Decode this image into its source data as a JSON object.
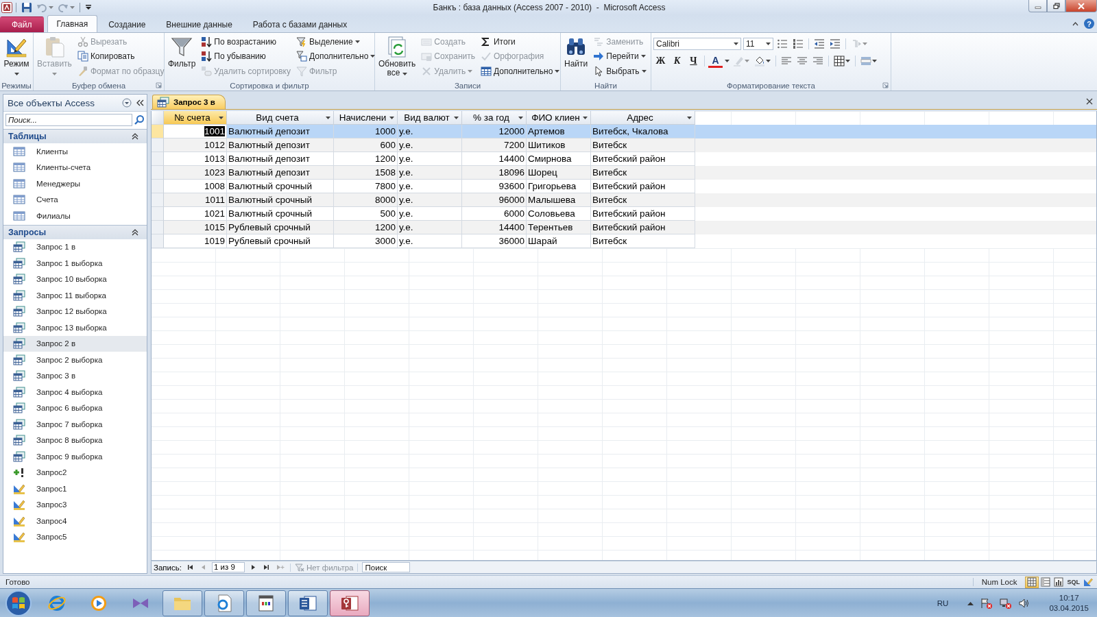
{
  "window": {
    "title": "Банкъ : база данных (Access 2007 - 2010)  -  Microsoft Access"
  },
  "quick_access": [
    {
      "kind": "save",
      "disabled": false
    },
    {
      "kind": "undo",
      "disabled": true
    },
    {
      "kind": "redo",
      "disabled": true
    }
  ],
  "ribbon_tabs": [
    {
      "label": "Файл",
      "kind": "file",
      "selected": false
    },
    {
      "label": "Главная",
      "kind": "tab",
      "selected": true
    },
    {
      "label": "Создание",
      "kind": "tab",
      "selected": false
    },
    {
      "label": "Внешние данные",
      "kind": "tab",
      "selected": false
    },
    {
      "label": "Работа с базами данных",
      "kind": "tab",
      "selected": false
    }
  ],
  "help_button": "?",
  "ribbon_groups": [
    {
      "label": "Режимы",
      "launcher": false,
      "columns": [
        {
          "kind": "large",
          "items": [
            {
              "label": "Режим",
              "disabled": false,
              "dropdown": true
            }
          ]
        }
      ]
    },
    {
      "label": "Буфер обмена",
      "launcher": true,
      "columns": [
        {
          "kind": "large",
          "items": [
            {
              "label": "Вставить",
              "disabled": true,
              "dropdown": true
            }
          ]
        },
        {
          "kind": "small",
          "items": [
            {
              "label": "Вырезать",
              "disabled": true,
              "dropdown": false
            },
            {
              "label": "Копировать",
              "disabled": false,
              "dropdown": false
            },
            {
              "label": "Формат по образцу",
              "disabled": true,
              "dropdown": false
            }
          ]
        }
      ]
    },
    {
      "label": "Сортировка и фильтр",
      "launcher": false,
      "columns": [
        {
          "kind": "large",
          "items": [
            {
              "label": "Фильтр",
              "disabled": false,
              "dropdown": false
            }
          ]
        },
        {
          "kind": "small",
          "items": [
            {
              "label": "По возрастанию",
              "disabled": false,
              "dropdown": false
            },
            {
              "label": "По убыванию",
              "disabled": false,
              "dropdown": false
            },
            {
              "label": "Удалить сортировку",
              "disabled": true,
              "dropdown": false
            }
          ]
        },
        {
          "kind": "small",
          "items": [
            {
              "label": "Выделение",
              "disabled": false,
              "dropdown": true
            },
            {
              "label": "Дополнительно",
              "disabled": false,
              "dropdown": true
            },
            {
              "label": "Фильтр",
              "disabled": true,
              "dropdown": false
            }
          ]
        }
      ]
    },
    {
      "label": "Записи",
      "launcher": false,
      "columns": [
        {
          "kind": "large",
          "items": [
            {
              "label": "Обновить все",
              "disabled": false,
              "dropdown": true
            }
          ]
        },
        {
          "kind": "small",
          "items": [
            {
              "label": "Создать",
              "disabled": true,
              "dropdown": false
            },
            {
              "label": "Сохранить",
              "disabled": true,
              "dropdown": false
            },
            {
              "label": "Удалить",
              "disabled": true,
              "dropdown": true
            }
          ]
        },
        {
          "kind": "small",
          "items": [
            {
              "label": "Итоги",
              "disabled": false,
              "dropdown": false
            },
            {
              "label": "Орфография",
              "disabled": true,
              "dropdown": false
            },
            {
              "label": "Дополнительно",
              "disabled": false,
              "dropdown": true
            }
          ]
        }
      ]
    },
    {
      "label": "Найти",
      "launcher": false,
      "columns": [
        {
          "kind": "large",
          "items": [
            {
              "label": "Найти",
              "disabled": false,
              "dropdown": false
            }
          ]
        },
        {
          "kind": "small",
          "items": [
            {
              "label": "Заменить",
              "disabled": true,
              "dropdown": false
            },
            {
              "label": "Перейти",
              "disabled": false,
              "dropdown": true
            },
            {
              "label": "Выбрать",
              "disabled": false,
              "dropdown": true
            }
          ]
        }
      ]
    },
    {
      "label": "Форматирование текста",
      "launcher": true,
      "columns": [
        {
          "kind": "format",
          "font": "Calibri",
          "size": "11",
          "style_buttons": [
            "Ж",
            "К",
            "Ч"
          ],
          "color_button": "A"
        }
      ]
    }
  ],
  "nav": {
    "title": "Все объекты Access",
    "placeholder": "Поиск...",
    "sections": [
      {
        "title": "Таблицы",
        "expanded": true,
        "items": [
          {
            "label": "Клиенты",
            "kind": "table",
            "selected": false
          },
          {
            "label": "Клиенты-счета",
            "kind": "table",
            "selected": false
          },
          {
            "label": "Менеджеры",
            "kind": "table",
            "selected": false
          },
          {
            "label": "Счета",
            "kind": "table",
            "selected": false
          },
          {
            "label": "Филиалы",
            "kind": "table",
            "selected": false
          }
        ]
      },
      {
        "title": "Запросы",
        "expanded": true,
        "items": [
          {
            "label": "Запрос 1 в",
            "kind": "select",
            "selected": false
          },
          {
            "label": "Запрос 1 выборка",
            "kind": "select",
            "selected": false
          },
          {
            "label": "Запрос 10 выборка",
            "kind": "select",
            "selected": false
          },
          {
            "label": "Запрос 11 выборка",
            "kind": "select",
            "selected": false
          },
          {
            "label": "Запрос 12 выборка",
            "kind": "select",
            "selected": false
          },
          {
            "label": "Запрос 13 выборка",
            "kind": "select",
            "selected": false
          },
          {
            "label": "Запрос 2 в",
            "kind": "select",
            "selected": true
          },
          {
            "label": "Запрос 2 выборка",
            "kind": "select",
            "selected": false
          },
          {
            "label": "Запрос 3 в",
            "kind": "select",
            "selected": false
          },
          {
            "label": "Запрос 4 выборка",
            "kind": "select",
            "selected": false
          },
          {
            "label": "Запрос 6 выборка",
            "kind": "select",
            "selected": false
          },
          {
            "label": "Запрос 7 выборка",
            "kind": "select",
            "selected": false
          },
          {
            "label": "Запрос 8 выборка",
            "kind": "select",
            "selected": false
          },
          {
            "label": "Запрос 9 выборка",
            "kind": "select",
            "selected": false
          },
          {
            "label": "Запрос2",
            "kind": "append",
            "selected": false
          },
          {
            "label": "Запрос1",
            "kind": "design",
            "selected": false
          },
          {
            "label": "Запрос3",
            "kind": "design",
            "selected": false
          },
          {
            "label": "Запрос4",
            "kind": "design",
            "selected": false
          },
          {
            "label": "Запрос5",
            "kind": "design",
            "selected": false
          }
        ]
      }
    ]
  },
  "document_tabs": [
    {
      "label": "Запрос 3 в",
      "selected": true
    }
  ],
  "table": {
    "columns": [
      {
        "label": "№ счета",
        "kind": "number",
        "selected": true
      },
      {
        "label": "Вид счета",
        "kind": "text",
        "selected": false
      },
      {
        "label": "Начислени",
        "kind": "number",
        "selected": false
      },
      {
        "label": "Вид валют",
        "kind": "text",
        "selected": false
      },
      {
        "label": "% за год",
        "kind": "number",
        "selected": false
      },
      {
        "label": "ФИО клиен",
        "kind": "text",
        "selected": false
      },
      {
        "label": "Адрес",
        "kind": "text",
        "selected": false
      }
    ],
    "rows": [
      {
        "selected": true,
        "cells": [
          "1001",
          "Валютный депозит",
          "1000",
          "у.е.",
          "12000",
          "Артемов",
          "Витебск, Чкалова"
        ]
      },
      {
        "selected": false,
        "cells": [
          "1012",
          "Валютный депозит",
          "600",
          "у.е.",
          "7200",
          "Шитиков",
          "Витебск"
        ]
      },
      {
        "selected": false,
        "cells": [
          "1013",
          "Валютный депозит",
          "1200",
          "у.е.",
          "14400",
          "Смирнова",
          "Витебский район"
        ]
      },
      {
        "selected": false,
        "cells": [
          "1023",
          "Валютный депозит",
          "1508",
          "у.е.",
          "18096",
          "Шорец",
          "Витебск"
        ]
      },
      {
        "selected": false,
        "cells": [
          "1008",
          "Валютный срочный",
          "7800",
          "у.е.",
          "93600",
          "Григорьева",
          "Витебский район"
        ]
      },
      {
        "selected": false,
        "cells": [
          "1011",
          "Валютный срочный",
          "8000",
          "у.е.",
          "96000",
          "Малышева",
          "Витебск"
        ]
      },
      {
        "selected": false,
        "cells": [
          "1021",
          "Валютный срочный",
          "500",
          "у.е.",
          "6000",
          "Соловьева",
          "Витебский район"
        ]
      },
      {
        "selected": false,
        "cells": [
          "1015",
          "Рублевый срочный",
          "1200",
          "у.е.",
          "14400",
          "Терентьев",
          "Витебский район"
        ]
      },
      {
        "selected": false,
        "cells": [
          "1019",
          "Рублевый срочный",
          "3000",
          "у.е.",
          "36000",
          "Шарай",
          "Витебск"
        ]
      }
    ]
  },
  "record_nav": {
    "label": "Запись:",
    "position": "1 из 9",
    "filter": "Нет фильтра",
    "filtered": false,
    "placeholder": "Поиск"
  },
  "status_bar": {
    "text": "Готово",
    "indicators": [
      "Num Lock"
    ],
    "views": [
      {
        "kind": "datasheet",
        "selected": true
      },
      {
        "kind": "pivot_table",
        "selected": false
      },
      {
        "kind": "pivot_chart",
        "selected": false
      },
      {
        "kind": "sql",
        "label": "SQL",
        "selected": false
      },
      {
        "kind": "design",
        "selected": false
      }
    ]
  },
  "taskbar": {
    "apps": [
      {
        "kind": "ie",
        "open": false,
        "selected": false
      },
      {
        "kind": "media",
        "open": false,
        "selected": false
      },
      {
        "kind": "vs",
        "open": false,
        "selected": false
      },
      {
        "kind": "folder",
        "open": true,
        "selected": false
      },
      {
        "kind": "iedoc",
        "open": true,
        "selected": false
      },
      {
        "kind": "appw",
        "open": true,
        "selected": false
      },
      {
        "kind": "word",
        "open": true,
        "selected": false
      },
      {
        "kind": "access",
        "open": true,
        "selected": true
      }
    ],
    "language": "RU",
    "time": "10:17",
    "date": "03.04.2015"
  }
}
